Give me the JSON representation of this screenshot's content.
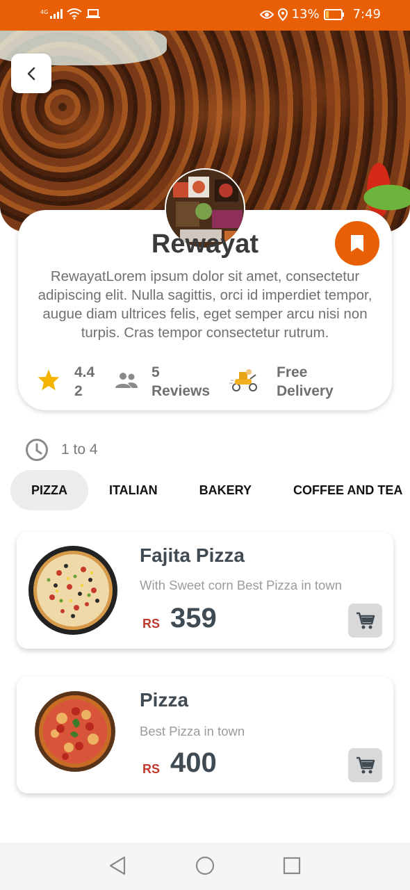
{
  "status_bar": {
    "network": "4G",
    "battery": "13%",
    "time": "7:49"
  },
  "restaurant": {
    "name": "Rewayat",
    "description": "RewayatLorem ipsum dolor sit amet, consectetur adipiscing elit. Nulla sagittis, orci id imperdiet tempor, augue diam ultrices felis, eget semper arcu nisi non turpis. Cras tempor consectetur rutrum.",
    "rating_line1": "4.4",
    "rating_line2": "2",
    "reviews_line1": "5",
    "reviews_line2": "Reviews",
    "delivery_line1": "Free",
    "delivery_line2": "Delivery",
    "timing": "1 to 4"
  },
  "tabs": [
    "PIZZA",
    "ITALIAN",
    "BAKERY",
    "COFFEE AND TEA"
  ],
  "products": [
    {
      "name": "Fajita Pizza",
      "description": "With Sweet corn Best Pizza in town",
      "currency": "RS",
      "price": "359"
    },
    {
      "name": "Pizza",
      "description": "Best Pizza in town",
      "currency": "RS",
      "price": "400"
    }
  ],
  "colors": {
    "accent": "#e85f05",
    "star": "#f5b400",
    "currency": "#c0392b"
  },
  "icons": [
    "back-icon",
    "bookmark-icon",
    "star-icon",
    "people-icon",
    "delivery-scooter-icon",
    "clock-icon",
    "cart-icon"
  ]
}
